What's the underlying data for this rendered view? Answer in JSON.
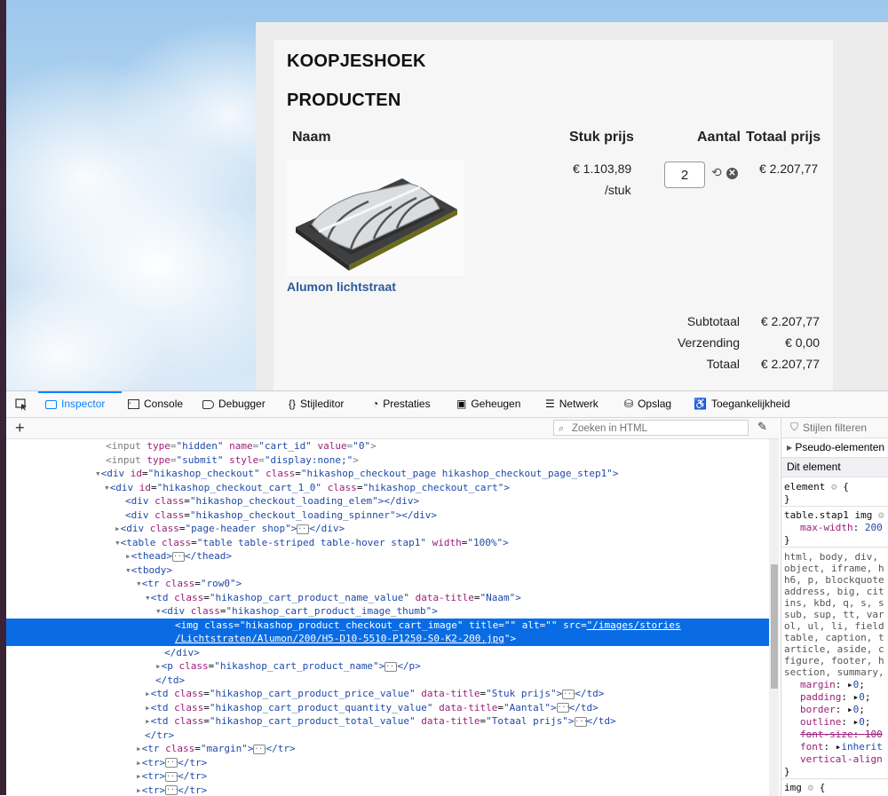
{
  "shop": {
    "heading1": "KOOPJESHOEK",
    "heading2": "PRODUCTEN",
    "columns": {
      "name": "Naam",
      "unit_price": "Stuk prijs",
      "quantity": "Aantal",
      "total_price": "Totaal prijs"
    },
    "product": {
      "name": "Alumon lichtstraat",
      "unit_price": "€ 1.103,89",
      "unit_suffix": "/stuk",
      "quantity": "2",
      "total": "€ 2.207,77"
    },
    "summary": [
      {
        "label": "Subtotaal",
        "value": "€ 2.207,77"
      },
      {
        "label": "Verzending",
        "value": "€ 0,00"
      },
      {
        "label": "Totaal",
        "value": "€ 2.207,77"
      }
    ]
  },
  "devtools": {
    "tabs": [
      "Inspector",
      "Console",
      "Debugger",
      "Stijleditor",
      "Prestaties",
      "Geheugen",
      "Netwerk",
      "Opslag",
      "Toegankelijkheid"
    ],
    "active_tab": "Inspector",
    "search_placeholder": "Zoeken in HTML",
    "styles_filter_placeholder": "Stijlen filteren",
    "markup_lines": [
      "<input type=\"hidden\" name=\"cart_id\" value=\"0\">",
      "<input type=\"submit\" style=\"display:none;\">",
      "<div id=\"hikashop_checkout\" class=\"hikashop_checkout_page hikashop_checkout_page_step1\">",
      "<div id=\"hikashop_checkout_cart_1_0\" class=\"hikashop_checkout_cart\">",
      "<div class=\"hikashop_checkout_loading_elem\"></div>",
      "<div class=\"hikashop_checkout_loading_spinner\"></div>",
      "<div class=\"page-header shop\">",
      "</div>",
      "<table class=\"table table-striped table-hover stap1\" width=\"100%\">",
      "<thead>",
      "</thead>",
      "<tbody>",
      "<tr class=\"row0\">",
      "<td class=\"hikashop_cart_product_name_value\" data-title=\"Naam\">",
      "<div class=\"hikashop_cart_product_image_thumb\">",
      "<img class=\"hikashop_product_checkout_cart_image\" title=\"\" alt=\"\" src=\"/images/stories",
      "/Lichtstraten/Alumon/200/H5-D10-5510-P1250-S0-K2-200.jpg\">",
      "</div>",
      "<p class=\"hikashop_cart_product_name\">",
      "</p>",
      "</td>",
      "<td class=\"hikashop_cart_product_price_value\" data-title=\"Stuk prijs\">",
      "<td class=\"hikashop_cart_product_quantity_value\" data-title=\"Aantal\">",
      "<td class=\"hikashop_cart_product_total_value\" data-title=\"Totaal prijs\">",
      "</td>",
      "</tr>",
      "<tr class=\"margin\">",
      "<tr>"
    ],
    "rules": {
      "pseudo": "Pseudo-elementen",
      "this_element": "Dit element",
      "element_rule": "element",
      "open_brace": "{",
      "close_brace": "}",
      "img_selector": "table.stap1 img",
      "max_width_prop": "max-width",
      "max_width_val": "200",
      "reset_selectors": [
        "html, body, div,",
        "object, iframe, h",
        "h6, p, blockquote",
        "address, big, cit",
        "ins, kbd, q, s, s",
        "sub, sup, tt, var",
        "ol, ul, li, field",
        "table, caption, t",
        "article, aside, c",
        "figure, footer, h",
        "section, summary,"
      ],
      "reset_props": [
        {
          "k": "margin",
          "v": "0"
        },
        {
          "k": "padding",
          "v": "0"
        },
        {
          "k": "border",
          "v": "0"
        },
        {
          "k": "outline",
          "v": "0"
        },
        {
          "k": "font-size",
          "v": "100"
        },
        {
          "k": "font",
          "v": "inherit"
        },
        {
          "k": "vertical-align",
          "v": ""
        }
      ],
      "img_rule": "img"
    }
  }
}
